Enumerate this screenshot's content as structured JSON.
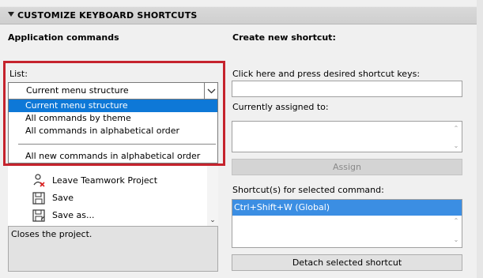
{
  "section": {
    "title": "CUSTOMIZE KEYBOARD SHORTCUTS"
  },
  "left": {
    "heading": "Application commands",
    "list_label": "List:",
    "select_value": "Current menu structure",
    "dropdown_options": [
      "Current menu structure",
      "All commands by theme",
      "All commands in alphabetical order",
      "All new commands in alphabetical order"
    ],
    "commands": [
      {
        "label": "Leave Teamwork Project",
        "icon": "teamwork-leave-icon"
      },
      {
        "label": "Save",
        "icon": "floppy-disk-icon"
      },
      {
        "label": "Save as...",
        "icon": "floppy-disk-as-icon"
      }
    ],
    "description": "Closes the project."
  },
  "right": {
    "heading": "Create new shortcut:",
    "press_label": "Click here and press desired shortcut keys:",
    "press_value": "",
    "assigned_label": "Currently assigned to:",
    "assign_button": "Assign",
    "shortcuts_label": "Shortcut(s) for selected command:",
    "shortcuts": [
      "Ctrl+Shift+W (Global)"
    ],
    "detach_button": "Detach selected shortcut"
  },
  "colors": {
    "highlight_frame": "#c5232d",
    "selection_blue": "#0e78d7",
    "shortcut_selection": "#3b8ee3"
  }
}
